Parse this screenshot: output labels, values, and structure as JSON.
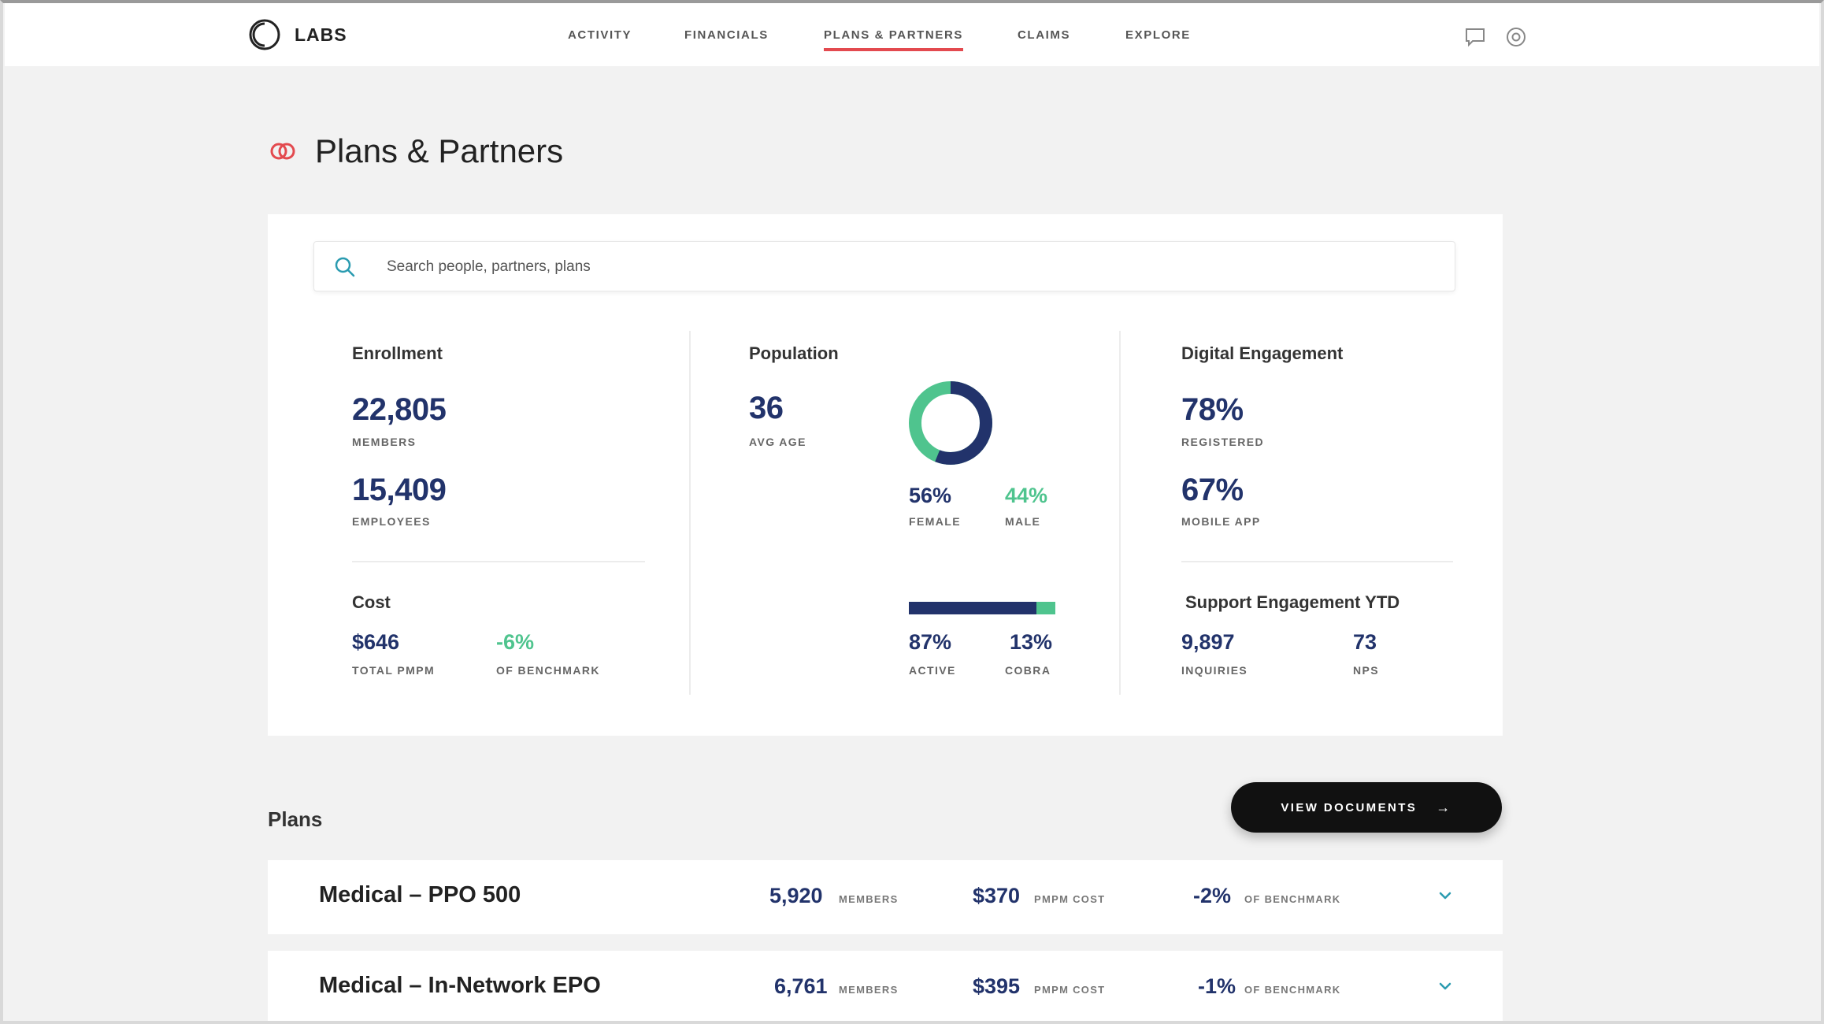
{
  "header": {
    "logo_text": "LABS",
    "nav": [
      {
        "label": "ACTIVITY"
      },
      {
        "label": "FINANCIALS"
      },
      {
        "label": "PLANS & PARTNERS",
        "active": true
      },
      {
        "label": "CLAIMS"
      },
      {
        "label": "EXPLORE"
      }
    ],
    "icons": [
      "chat-icon",
      "settings-icon"
    ],
    "accent_color": "#e34a4f"
  },
  "page": {
    "title": "Plans & Partners",
    "title_icon": "link-rings-icon"
  },
  "search": {
    "placeholder": "Search people, partners, plans"
  },
  "enrollment": {
    "title": "Enrollment",
    "members_value": "22,805",
    "members_label": "MEMBERS",
    "employees_value": "15,409",
    "employees_label": "EMPLOYEES"
  },
  "cost": {
    "title": "Cost",
    "pmpm_value": "$646",
    "pmpm_label": "TOTAL PMPM",
    "benchmark_value": "-6%",
    "benchmark_label": "OF BENCHMARK"
  },
  "population": {
    "title": "Population",
    "age_value": "36",
    "age_label": "AVG AGE",
    "female_value": "56%",
    "female_label": "FEMALE",
    "male_value": "44%",
    "male_label": "MALE",
    "female_fraction": 0.56,
    "active_value": "87%",
    "active_label": "ACTIVE",
    "cobra_value": "13%",
    "cobra_label": "COBRA",
    "active_fraction": 0.87
  },
  "digital": {
    "title": "Digital Engagement",
    "registered_value": "78%",
    "registered_label": "REGISTERED",
    "mobile_value": "67%",
    "mobile_label": "MOBILE APP"
  },
  "support": {
    "title": "Support Engagement YTD",
    "inquiries_value": "9,897",
    "inquiries_label": "INQUIRIES",
    "nps_value": "73",
    "nps_label": "NPS"
  },
  "colors": {
    "navy": "#22336b",
    "green": "#4fc48e"
  },
  "plans": {
    "title": "Plans",
    "view_documents_label": "VIEW DOCUMENTS",
    "rows": [
      {
        "name": "Medical – PPO 500",
        "members": "5,920",
        "members_label": "MEMBERS",
        "cost": "$370",
        "cost_label": "PMPM COST",
        "benchmark": "-2%",
        "benchmark_label": "OF BENCHMARK"
      },
      {
        "name": "Medical – In-Network EPO",
        "members": "6,761",
        "members_label": "MEMBERS",
        "cost": "$395",
        "cost_label": "PMPM COST",
        "benchmark": "-1%",
        "benchmark_label": "OF BENCHMARK"
      }
    ]
  }
}
